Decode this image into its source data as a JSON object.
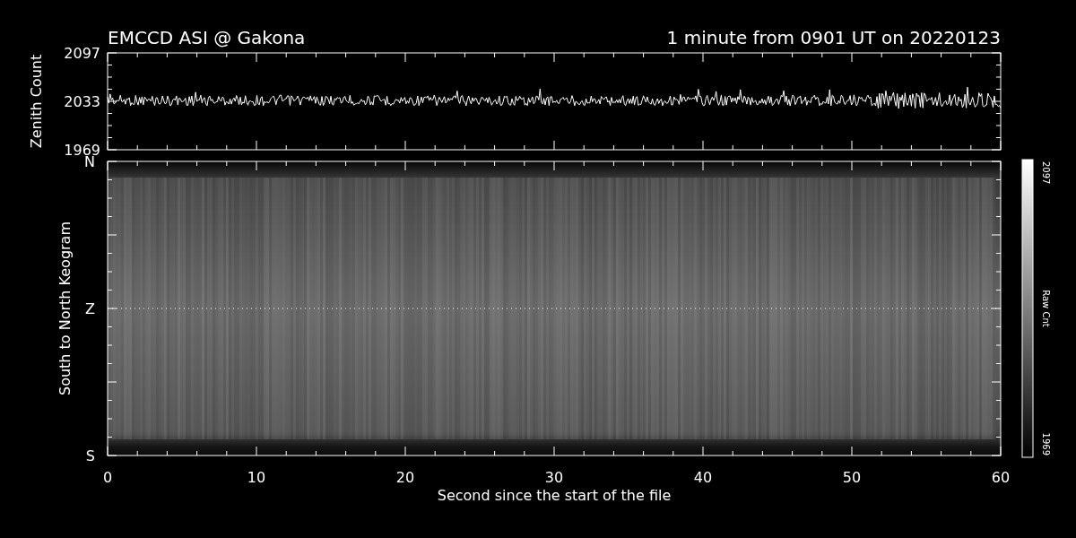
{
  "header": {
    "title": "EMCCD ASI @ Gakona",
    "subtitle": "1 minute from 0901 UT on 20220123"
  },
  "zenith_panel": {
    "ylabel": "Zenith Count",
    "yticks": [
      "2097",
      "2033",
      "1969"
    ]
  },
  "keogram_panel": {
    "ylabel": "South to North Keogram",
    "yticks": [
      "N",
      "Z",
      "S"
    ],
    "xticks": [
      "0",
      "10",
      "20",
      "30",
      "40",
      "50",
      "60"
    ],
    "xlabel": "Second since the start of the file"
  },
  "colorbar": {
    "max": "2097",
    "label": "Raw Cnt",
    "min": "1969"
  }
}
